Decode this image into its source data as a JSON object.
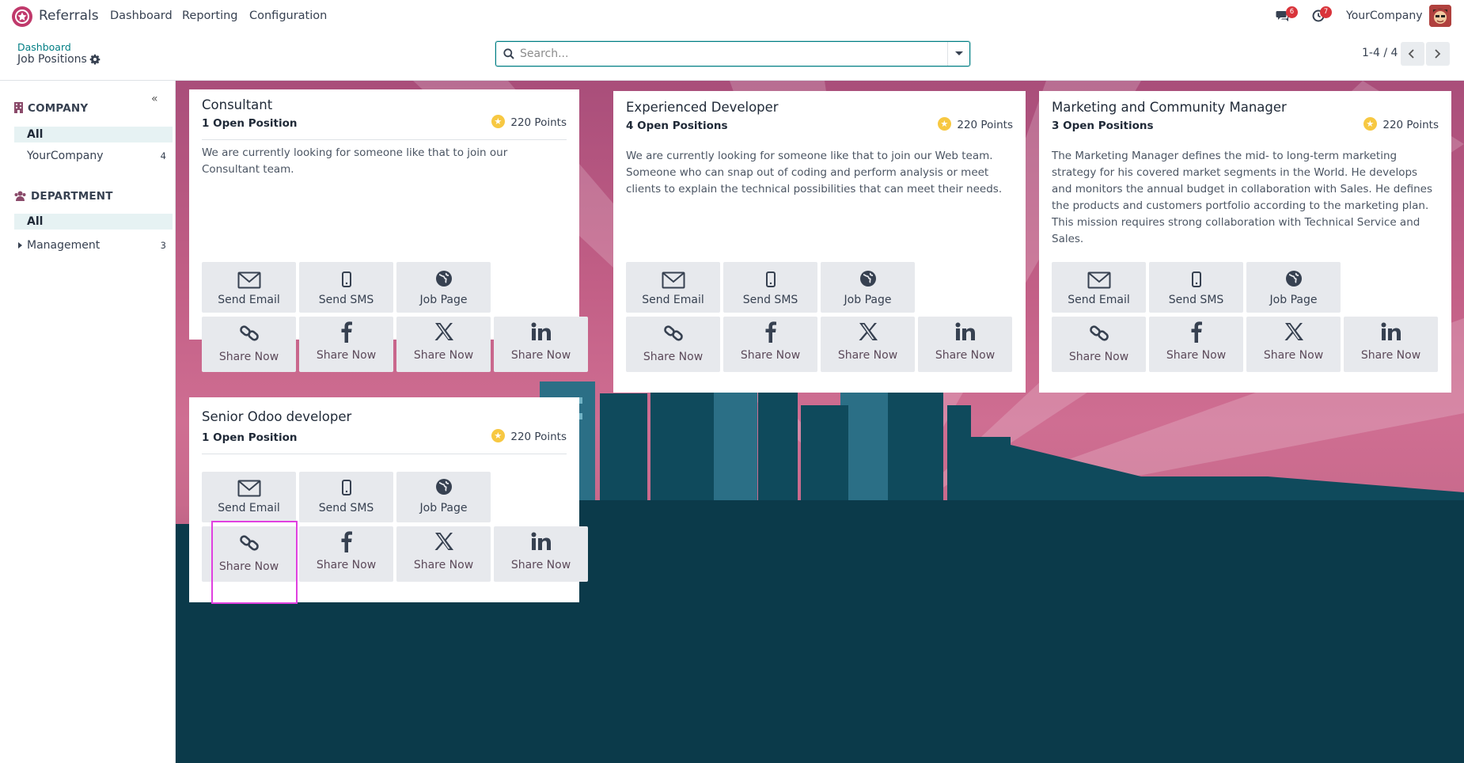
{
  "navbar": {
    "app_name": "Referrals",
    "menus": [
      "Dashboard",
      "Reporting",
      "Configuration"
    ],
    "messages_badge": "6",
    "activities_badge": "7",
    "company": "YourCompany"
  },
  "control_panel": {
    "breadcrumb_parent": "Dashboard",
    "breadcrumb_current": "Job Positions",
    "search_placeholder": "Search...",
    "pager": "1-4 / 4"
  },
  "sidebar": {
    "company_header": "COMPANY",
    "company_items": [
      {
        "label": "All",
        "count": ""
      },
      {
        "label": "YourCompany",
        "count": "4"
      }
    ],
    "department_header": "DEPARTMENT",
    "department_items": [
      {
        "label": "All",
        "count": ""
      },
      {
        "label": "Management",
        "count": "3"
      }
    ]
  },
  "buttons": {
    "send_email": "Send Email",
    "send_sms": "Send SMS",
    "job_page": "Job Page",
    "share_now": "Share Now"
  },
  "jobs": [
    {
      "title": "Consultant",
      "open_positions": "1 Open Position",
      "points": "220 Points",
      "description": "We are currently looking for someone like that to join our Consultant team."
    },
    {
      "title": "Experienced Developer",
      "open_positions": "4 Open Positions",
      "points": "220 Points",
      "description": "We are currently looking for someone like that to join our Web team. Someone who can snap out of coding and perform analysis or meet clients to explain the technical possibilities that can meet their needs."
    },
    {
      "title": "Marketing and Community Manager",
      "open_positions": "3 Open Positions",
      "points": "220 Points",
      "description": "The Marketing Manager defines the mid- to long-term marketing strategy for his covered market segments in the World. He develops and monitors the annual budget in collaboration with Sales. He defines the products and customers portfolio according to the marketing plan. This mission requires strong collaboration with Technical Service and Sales."
    },
    {
      "title": "Senior Odoo developer",
      "open_positions": "1 Open Position",
      "points": "220 Points",
      "description": ""
    }
  ],
  "colors": {
    "accent": "#017e84",
    "badge": "#d9343b",
    "highlight": "#e040e0"
  }
}
